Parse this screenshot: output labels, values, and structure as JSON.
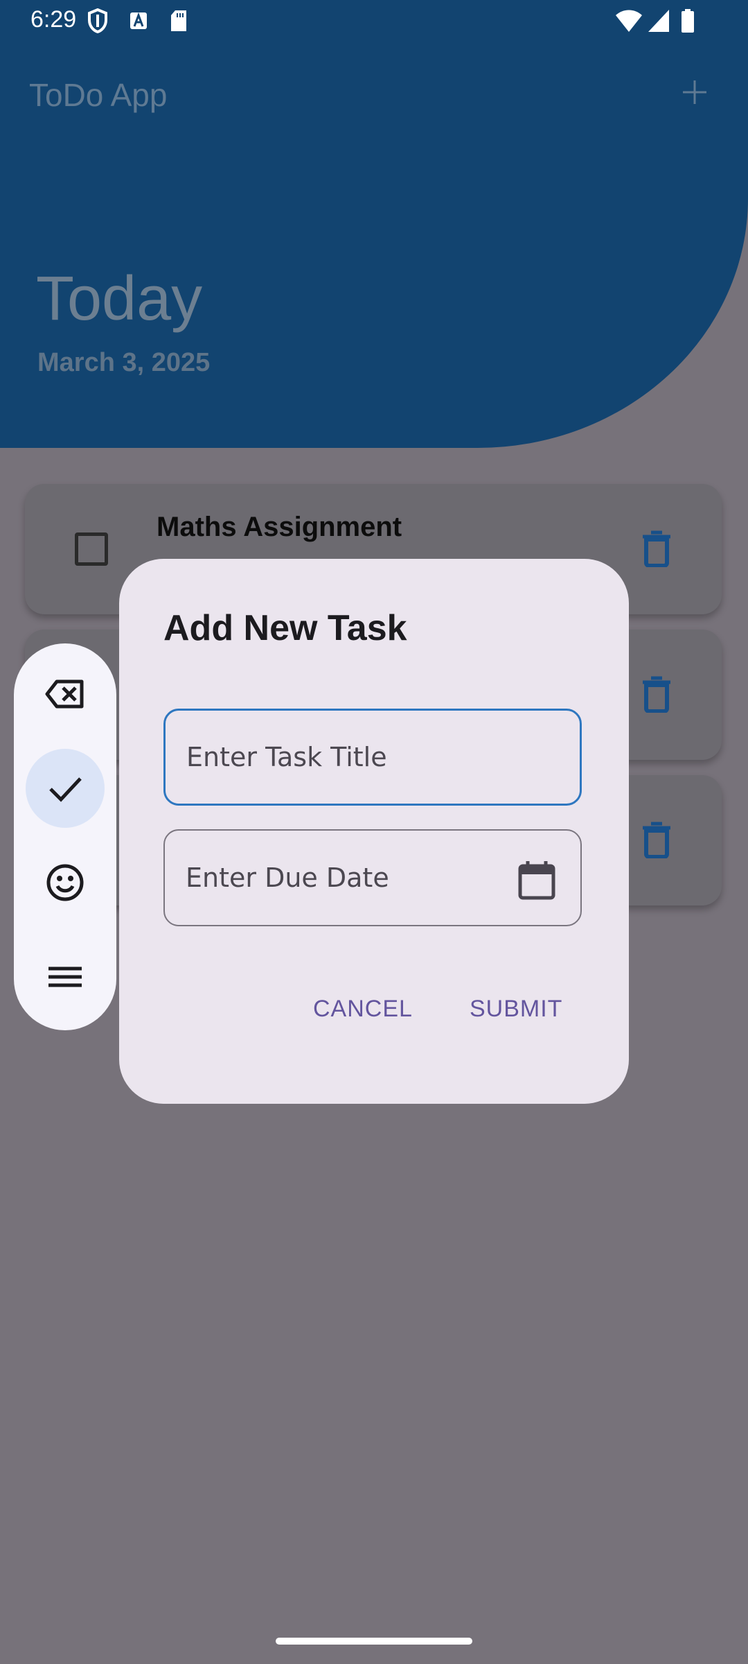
{
  "status_bar": {
    "time": "6:29"
  },
  "app_bar": {
    "title": "ToDo App"
  },
  "header": {
    "title": "Today",
    "date": "March 3, 2025"
  },
  "tasks": [
    {
      "title": "Maths Assignment",
      "completed": false
    },
    {
      "title": "",
      "completed": false
    },
    {
      "title": "",
      "completed": false
    }
  ],
  "dialog": {
    "title": "Add New Task",
    "task_title_placeholder": "Enter Task Title",
    "task_title_value": "",
    "due_date_placeholder": "Enter Due Date",
    "due_date_value": "",
    "cancel_label": "CANCEL",
    "submit_label": "SUBMIT"
  },
  "floating_toolbar": {
    "items": [
      "backspace-icon",
      "check-icon",
      "emoji-icon",
      "menu-icon"
    ],
    "active_item": "check-icon"
  },
  "colors": {
    "header_blue": "#124470",
    "accent_purple": "#63559e",
    "focus_blue": "#2e77c0",
    "dialog_surface": "#ebe5ee",
    "scrim_background": "#77727a"
  }
}
